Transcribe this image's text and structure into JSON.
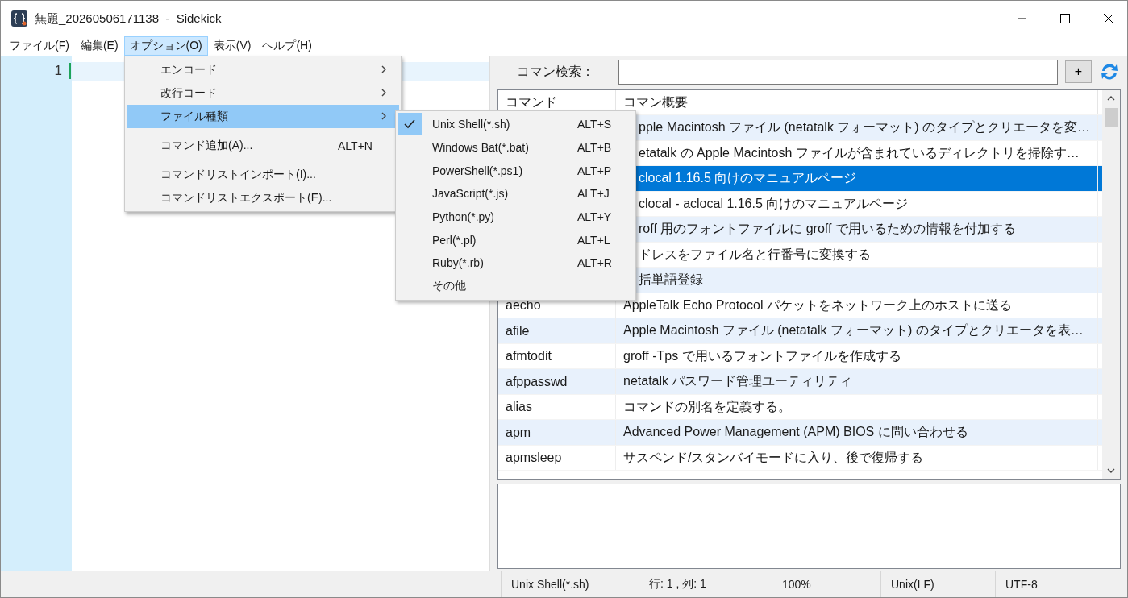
{
  "window": {
    "title": "無題_20260506171138  -  Sidekick"
  },
  "menu_bar": [
    {
      "label": "ファイル(F)",
      "selected": false
    },
    {
      "label": "編集(E)",
      "selected": false
    },
    {
      "label": "オプション(O)",
      "selected": true
    },
    {
      "label": "表示(V)",
      "selected": false
    },
    {
      "label": "ヘルプ(H)",
      "selected": false
    }
  ],
  "options_menu": [
    {
      "kind": "submenu",
      "label": "エンコード",
      "selected": false
    },
    {
      "kind": "submenu",
      "label": "改行コード",
      "selected": false
    },
    {
      "kind": "submenu",
      "label": "ファイル種類",
      "selected": true
    },
    {
      "kind": "separator"
    },
    {
      "kind": "item",
      "label": "コマンド追加(A)...",
      "shortcut": "ALT+N",
      "selected": false
    },
    {
      "kind": "separator"
    },
    {
      "kind": "item",
      "label": "コマンドリストインポート(I)...",
      "selected": false
    },
    {
      "kind": "item",
      "label": "コマンドリストエクスポート(E)...",
      "selected": false
    }
  ],
  "file_type_menu": [
    {
      "label": "Unix Shell(*.sh)",
      "shortcut": "ALT+S",
      "checked": true
    },
    {
      "label": "Windows Bat(*.bat)",
      "shortcut": "ALT+B",
      "checked": false
    },
    {
      "label": "PowerShell(*.ps1)",
      "shortcut": "ALT+P",
      "checked": false
    },
    {
      "label": "JavaScript(*.js)",
      "shortcut": "ALT+J",
      "checked": false
    },
    {
      "label": "Python(*.py)",
      "shortcut": "ALT+Y",
      "checked": false
    },
    {
      "label": "Perl(*.pl)",
      "shortcut": "ALT+L",
      "checked": false
    },
    {
      "label": "Ruby(*.rb)",
      "shortcut": "ALT+R",
      "checked": false
    },
    {
      "label": "その他",
      "checked": false
    }
  ],
  "editor": {
    "line_numbers": [
      "1"
    ]
  },
  "search": {
    "label": "コマン検索：",
    "add_button": "+"
  },
  "command_table": {
    "columns": [
      "コマンド",
      "コマン概要"
    ],
    "rows": [
      {
        "description": "pple Macintosh ファイル (netatalk フォーマット) のタイプとクリエータを変…",
        "selected": false
      },
      {
        "description": "etatalk の Apple Macintosh ファイルが含まれているディレクトリを掃除す…",
        "selected": false
      },
      {
        "description": "clocal 1.16.5 向けのマニュアルページ",
        "selected": true
      },
      {
        "description": "clocal - aclocal 1.16.5 向けのマニュアルページ",
        "selected": false
      },
      {
        "description": "roff 用のフォントファイルに groff で用いるための情報を付加する",
        "selected": false
      },
      {
        "description": "ドレスをファイル名と行番号に変換する",
        "selected": false
      },
      {
        "description": "括単語登録",
        "selected": false
      },
      {
        "command": "aecho",
        "description": "AppleTalk Echo Protocol パケットをネットワーク上のホストに送る",
        "selected": false
      },
      {
        "command": "afile",
        "description": "Apple Macintosh ファイル (netatalk フォーマット) のタイプとクリエータを表…",
        "selected": false
      },
      {
        "command": "afmtodit",
        "description": "groff -Tps で用いるフォントファイルを作成する",
        "selected": false
      },
      {
        "command": "afppasswd",
        "description": "netatalk パスワード管理ユーティリティ",
        "selected": false
      },
      {
        "command": "alias",
        "description": "コマンドの別名を定義する。",
        "selected": false
      },
      {
        "command": "apm",
        "description": "Advanced Power Management (APM) BIOS に問い合わせる",
        "selected": false
      },
      {
        "command": "apmsleep",
        "description": "サスペンド/スタンバイモードに入り、後で復帰する",
        "selected": false
      }
    ]
  },
  "status_bar": [
    "Unix Shell(*.sh)",
    "行: 1 , 列: 1",
    "100%",
    "Unix(LF)",
    "UTF-8"
  ]
}
